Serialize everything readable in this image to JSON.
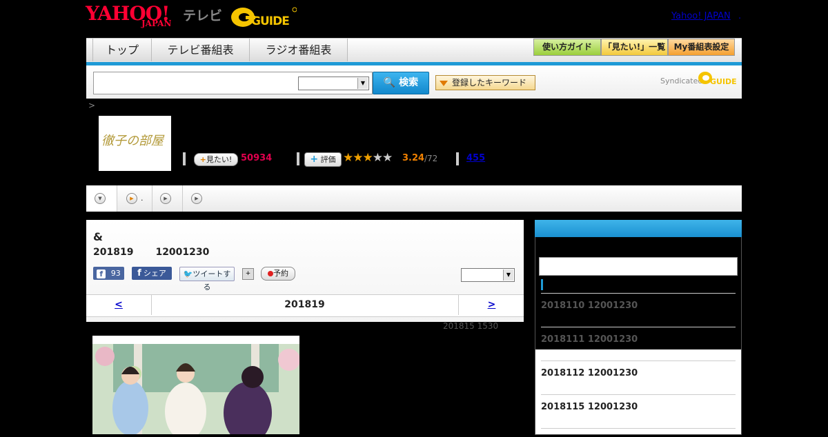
{
  "header": {
    "yahoo_logo": "YAHOO!",
    "japan_logo": "JAPAN",
    "tv_label": "テレビ",
    "gguide_logo": "G-GUIDE",
    "yahoo_japan_link": "Yahoo! JAPAN",
    "link_sep": "."
  },
  "nav": {
    "tabs": [
      "トップ",
      "テレビ番組表",
      "ラジオ番組表"
    ],
    "buttons": [
      "使い方ガイド",
      "「見たい!」一覧",
      "My番組表設定"
    ]
  },
  "search": {
    "button_label": "検索",
    "keyword_button": "登録したキーワード",
    "syndicated": "Syndicated",
    "gguide_small": "G-GUIDE"
  },
  "breadcrumb": {
    "sep": ">"
  },
  "program": {
    "thumb_text": "徹子の部屋",
    "want_label": "見たい!",
    "want_count": "50934",
    "rate_label": "評価",
    "rating": 3.24,
    "rating_score": "3.24",
    "rating_total": "/72",
    "review_count": "455",
    "tab2_text": "."
  },
  "main": {
    "title": "&",
    "date": "201819",
    "time": "12001230",
    "fb_count": "93",
    "share_label": "シェア",
    "tweet_label": "ツイートする",
    "reserve_label": "予約",
    "prev": "<",
    "next": ">",
    "pager_date": "201819",
    "update_date": "201815",
    "update_time": "1530"
  },
  "sidebar": {
    "items": [
      {
        "date": "2018110",
        "time": "12001230"
      },
      {
        "date": "2018111",
        "time": "12001230"
      },
      {
        "date": "2018112",
        "time": "12001230"
      },
      {
        "date": "2018115",
        "time": "12001230"
      }
    ]
  },
  "colors": {
    "accent_blue": "#1e9ad6",
    "want_pink": "#e0004d",
    "rating_orange": "#f08000",
    "yahoo_red": "#ff0033"
  }
}
